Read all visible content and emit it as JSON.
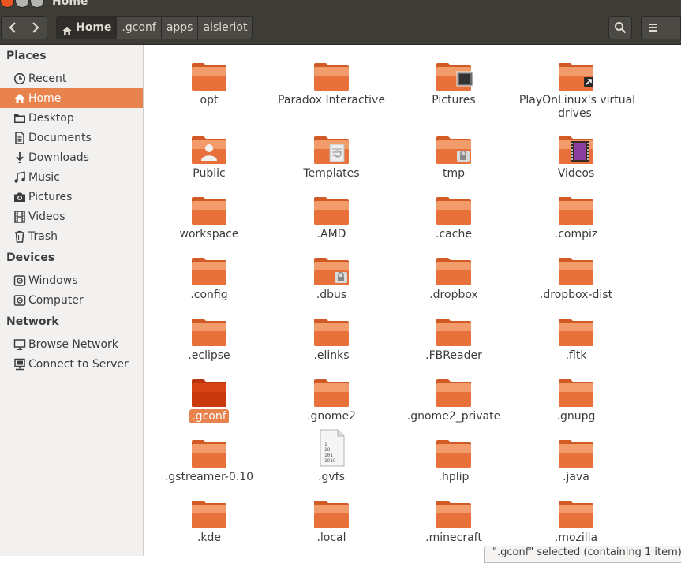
{
  "window": {
    "title": "Home"
  },
  "toolbar": {
    "breadcrumbs": [
      {
        "label": "Home",
        "icon": "home-icon",
        "active": true
      },
      {
        "label": ".gconf"
      },
      {
        "label": "apps"
      },
      {
        "label": "aisleriot"
      }
    ]
  },
  "sidebar": {
    "sections": [
      {
        "title": "Places",
        "items": [
          {
            "label": "Recent",
            "icon": "clock-icon"
          },
          {
            "label": "Home",
            "icon": "home-icon",
            "selected": true
          },
          {
            "label": "Desktop",
            "icon": "desktop-icon"
          },
          {
            "label": "Documents",
            "icon": "documents-icon"
          },
          {
            "label": "Downloads",
            "icon": "downloads-icon"
          },
          {
            "label": "Music",
            "icon": "music-icon"
          },
          {
            "label": "Pictures",
            "icon": "camera-icon"
          },
          {
            "label": "Videos",
            "icon": "film-icon"
          },
          {
            "label": "Trash",
            "icon": "trash-icon"
          }
        ]
      },
      {
        "title": "Devices",
        "items": [
          {
            "label": "Windows",
            "icon": "drive-icon"
          },
          {
            "label": "Computer",
            "icon": "drive-icon"
          }
        ]
      },
      {
        "title": "Network",
        "items": [
          {
            "label": "Browse Network",
            "icon": "network-icon"
          },
          {
            "label": "Connect to Server",
            "icon": "server-icon"
          }
        ]
      }
    ]
  },
  "files": [
    {
      "name": "opt",
      "emblem": ""
    },
    {
      "name": "Paradox Interactive",
      "emblem": ""
    },
    {
      "name": "Pictures",
      "emblem": "pictures"
    },
    {
      "name": "PlayOnLinux's virtual drives",
      "emblem": "link"
    },
    {
      "name": "Public",
      "emblem": "user"
    },
    {
      "name": "Templates",
      "emblem": "template"
    },
    {
      "name": "tmp",
      "emblem": "lock"
    },
    {
      "name": "Videos",
      "emblem": "film"
    },
    {
      "name": "workspace",
      "emblem": ""
    },
    {
      "name": ".AMD",
      "emblem": ""
    },
    {
      "name": ".cache",
      "emblem": ""
    },
    {
      "name": ".compiz",
      "emblem": ""
    },
    {
      "name": ".config",
      "emblem": ""
    },
    {
      "name": ".dbus",
      "emblem": "lock"
    },
    {
      "name": ".dropbox",
      "emblem": ""
    },
    {
      "name": ".dropbox-dist",
      "emblem": ""
    },
    {
      "name": ".eclipse",
      "emblem": ""
    },
    {
      "name": ".elinks",
      "emblem": ""
    },
    {
      "name": ".FBReader",
      "emblem": ""
    },
    {
      "name": ".fltk",
      "emblem": ""
    },
    {
      "name": ".gconf",
      "emblem": "",
      "selected": true
    },
    {
      "name": ".gnome2",
      "emblem": ""
    },
    {
      "name": ".gnome2_private",
      "emblem": ""
    },
    {
      "name": ".gnupg",
      "emblem": ""
    },
    {
      "name": ".gstreamer-0.10",
      "emblem": ""
    },
    {
      "name": ".gvfs",
      "emblem": "binary-file"
    },
    {
      "name": ".hplip",
      "emblem": ""
    },
    {
      "name": ".java",
      "emblem": ""
    },
    {
      "name": ".kde",
      "emblem": ""
    },
    {
      "name": ".local",
      "emblem": ""
    },
    {
      "name": ".minecraft",
      "emblem": ""
    },
    {
      "name": ".mozilla",
      "emblem": ""
    }
  ],
  "status": {
    "text": "\".gconf\" selected (containing 1 item)"
  },
  "colors": {
    "accent": "#e95420",
    "folder": "#e9834e",
    "selection": "#e9834e",
    "chrome": "#3d3c37"
  }
}
